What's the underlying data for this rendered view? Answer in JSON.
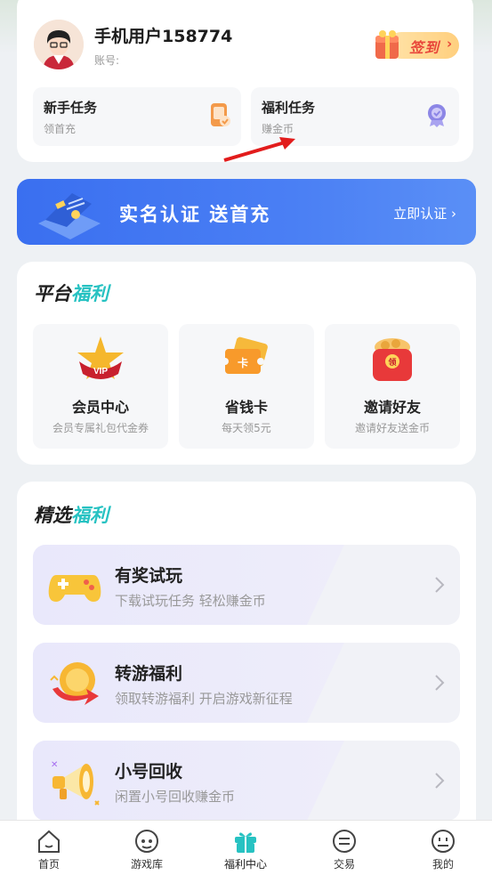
{
  "profile": {
    "username": "手机用户158774",
    "account_label": "账号:",
    "signin_label": "签到"
  },
  "tasks": [
    {
      "title": "新手任务",
      "subtitle": "领首充",
      "icon": "phone-task-icon"
    },
    {
      "title": "福利任务",
      "subtitle": "赚金币",
      "icon": "badge-icon"
    }
  ],
  "banner": {
    "title": "实名认证  送首充",
    "link_label": "立即认证 ›"
  },
  "platform": {
    "title_plain": "平台",
    "title_accent": "福利",
    "items": [
      {
        "title": "会员中心",
        "subtitle": "会员专属礼包代金券",
        "icon": "vip-crown-icon"
      },
      {
        "title": "省钱卡",
        "subtitle": "每天领5元",
        "icon": "ticket-card-icon"
      },
      {
        "title": "邀请好友",
        "subtitle": "邀请好友送金币",
        "icon": "red-envelope-icon"
      }
    ]
  },
  "featured": {
    "title_plain": "精选",
    "title_accent": "福利",
    "items": [
      {
        "title": "有奖试玩",
        "subtitle": "下载试玩任务 轻松赚金币",
        "icon": "gamepad-icon"
      },
      {
        "title": "转游福利",
        "subtitle": "领取转游福利 开启游戏新征程",
        "icon": "coin-swap-icon"
      },
      {
        "title": "小号回收",
        "subtitle": "闲置小号回收赚金币",
        "icon": "megaphone-icon"
      }
    ]
  },
  "tabbar": [
    {
      "label": "首页",
      "icon": "home-icon"
    },
    {
      "label": "游戏库",
      "icon": "game-library-icon"
    },
    {
      "label": "福利中心",
      "icon": "gift-icon"
    },
    {
      "label": "交易",
      "icon": "trade-icon"
    },
    {
      "label": "我的",
      "icon": "profile-icon"
    }
  ],
  "colors": {
    "accent": "#27c2c2",
    "banner": "#3a6ff0",
    "signin": "#e8463a"
  }
}
